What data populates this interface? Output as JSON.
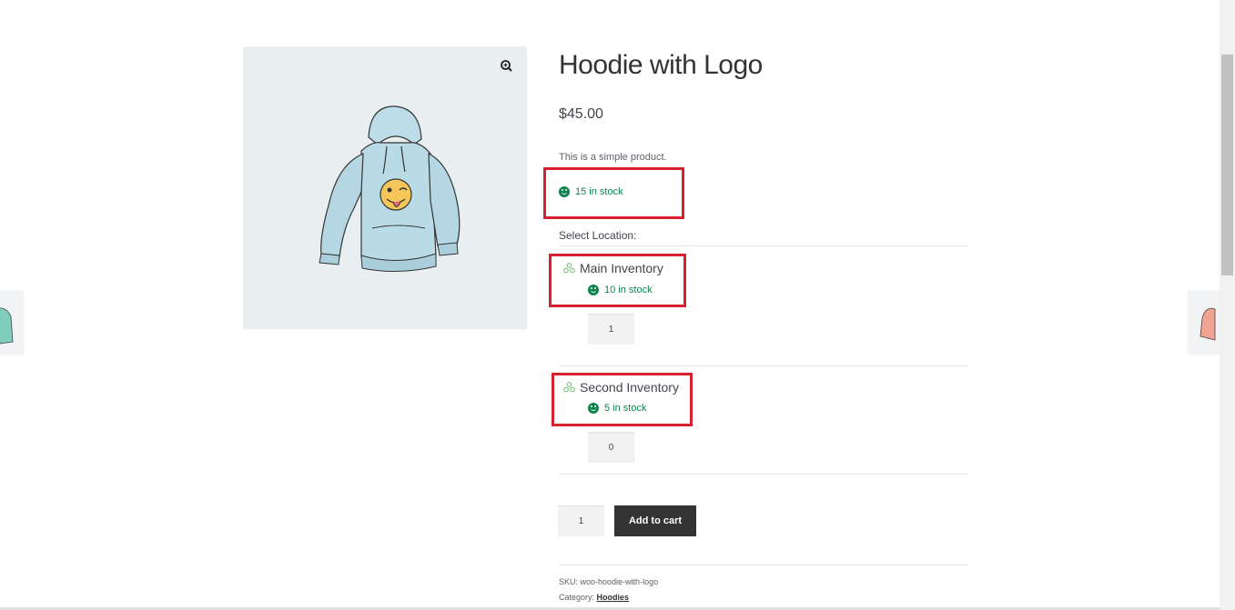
{
  "product": {
    "title": "Hoodie with Logo",
    "price": "$45.00",
    "description": "This is a simple product.",
    "stock": "15 in stock",
    "image_alt": "hoodie-with-logo"
  },
  "locations": {
    "label": "Select Location:",
    "items": [
      {
        "name": "Main Inventory",
        "stock": "10 in stock",
        "quantity": "1"
      },
      {
        "name": "Second Inventory",
        "stock": "5 in stock",
        "quantity": "0"
      }
    ]
  },
  "cart": {
    "quantity": "1",
    "button_label": "Add to cart"
  },
  "meta": {
    "sku_label": "SKU:",
    "sku": "woo-hoodie-with-logo",
    "category_label": "Category:",
    "category": "Hoodies"
  },
  "icons": {
    "zoom": "zoom-icon",
    "stock": "smiley-icon",
    "location": "location-icon"
  },
  "colors": {
    "stock_green": "#0f834d",
    "highlight_red": "#d8202e",
    "button_dark": "#333333",
    "gallery_bg": "#e9eef1"
  }
}
